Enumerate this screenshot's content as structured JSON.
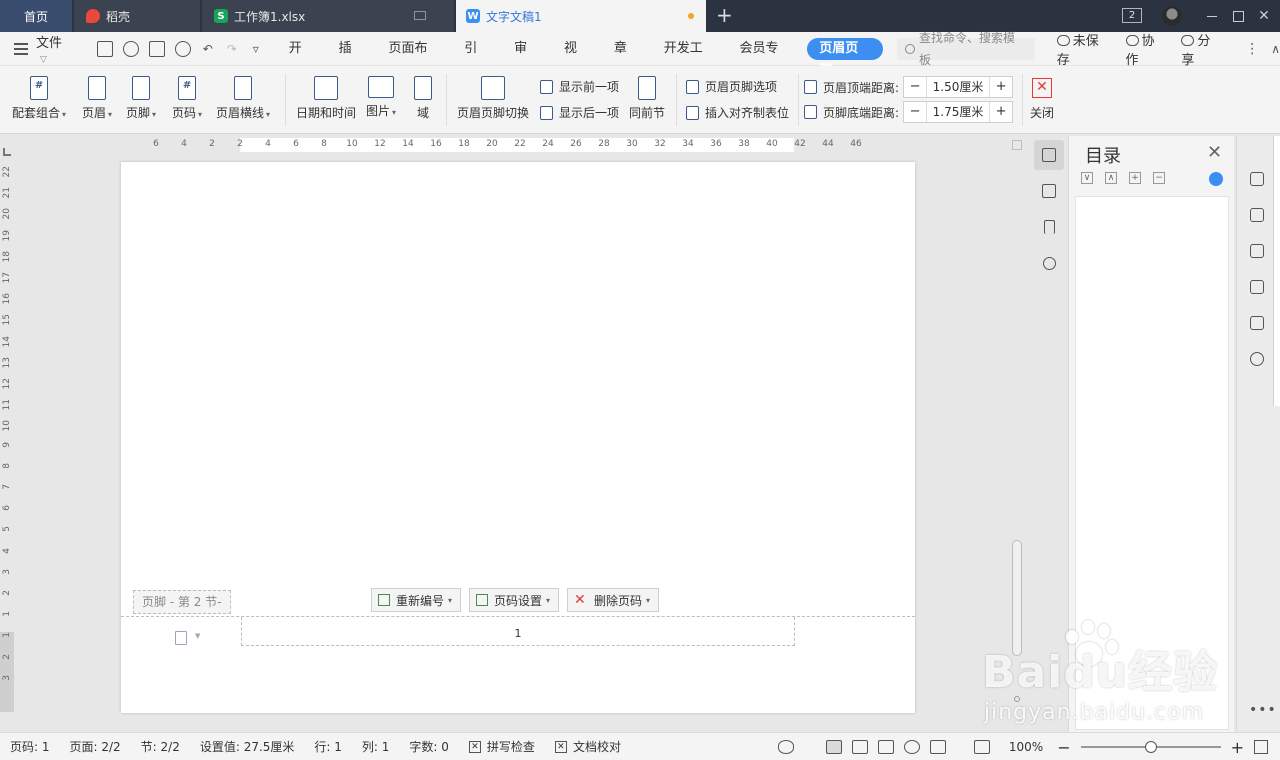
{
  "tabs": [
    {
      "label": "首页"
    },
    {
      "label": "稻壳"
    },
    {
      "label": "工作簿1.xlsx"
    },
    {
      "label": "文字文稿1"
    }
  ],
  "window": {
    "badge": "2"
  },
  "menubar": {
    "file": "文件",
    "menus": [
      "开始",
      "插入",
      "页面布局",
      "引用",
      "审阅",
      "视图",
      "章节",
      "开发工具",
      "会员专享"
    ],
    "active_menu": "页眉页脚",
    "search_placeholder": "查找命令、搜索模板",
    "unsaved": "未保存",
    "collab": "协作",
    "share": "分享"
  },
  "ribbon": {
    "combo": "配套组合",
    "header": "页眉",
    "footer": "页脚",
    "pagenum": "页码",
    "header_line": "页眉横线",
    "datetime": "日期和时间",
    "picture": "图片",
    "field": "域",
    "switch": "页眉页脚切换",
    "show_prev": "显示前一项",
    "show_next": "显示后一项",
    "same_prev": "同前节",
    "options": "页眉页脚选项",
    "insert_align_tab": "插入对齐制表位",
    "header_top_label": "页眉顶端距离:",
    "header_top_value": "1.50厘米",
    "footer_bottom_label": "页脚底端距离:",
    "footer_bottom_value": "1.75厘米",
    "close": "关闭"
  },
  "ruler": {
    "h_ticks": [
      "6",
      "4",
      "2",
      "2",
      "4",
      "6",
      "8",
      "10",
      "12",
      "14",
      "16",
      "18",
      "20",
      "22",
      "24",
      "26",
      "28",
      "30",
      "32",
      "34",
      "36",
      "38",
      "40",
      "42",
      "44",
      "46"
    ],
    "v_ticks": [
      "22",
      "21",
      "20",
      "19",
      "18",
      "17",
      "16",
      "15",
      "14",
      "13",
      "12",
      "11",
      "10",
      "9",
      "8",
      "7",
      "6",
      "5",
      "4",
      "3",
      "2",
      "1",
      "1",
      "2",
      "3"
    ]
  },
  "footer": {
    "tag": "页脚 - 第 2 节-",
    "renumber": "重新编号",
    "page_setup": "页码设置",
    "delete_page": "删除页码",
    "page_number": "1"
  },
  "toc": {
    "title": "目录"
  },
  "watermark": {
    "main": "Bai",
    "du": "du",
    "jingyan": "经验",
    "sub": "jingyan.baidu.com"
  },
  "status": {
    "page_no": "页码: 1",
    "pages": "页面: 2/2",
    "section": "节: 2/2",
    "setting": "设置值: 27.5厘米",
    "row": "行: 1",
    "col": "列: 1",
    "words": "字数: 0",
    "spell": "拼写检查",
    "proof": "文档校对",
    "zoom": "100%"
  },
  "colors": {
    "accent": "#3c8ef0",
    "tabbar": "#2b3340",
    "close_red": "#e03a3a"
  }
}
